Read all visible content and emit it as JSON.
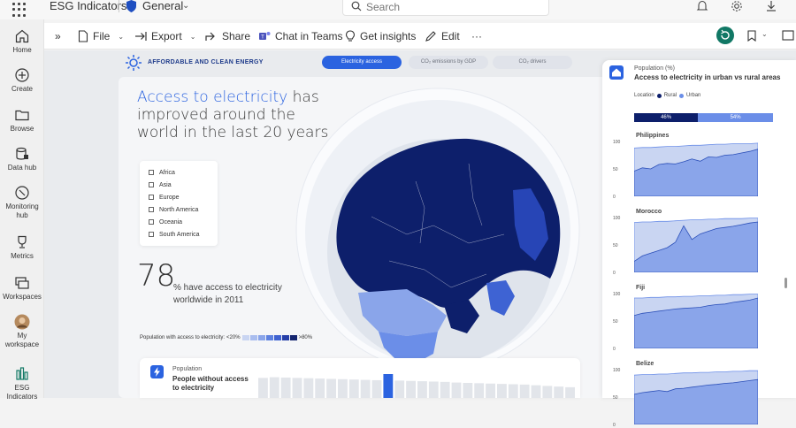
{
  "topbar": {
    "app_title": "ESG Indicators",
    "workspace": "General",
    "search_placeholder": "Search"
  },
  "leftnav": {
    "items": [
      {
        "label": "Home",
        "icon": "home-icon"
      },
      {
        "label": "Create",
        "icon": "plus-circle-icon"
      },
      {
        "label": "Browse",
        "icon": "folder-icon"
      },
      {
        "label": "Data hub",
        "icon": "database-icon"
      },
      {
        "label": "Monitoring hub",
        "icon": "monitor-icon"
      },
      {
        "label": "Metrics",
        "icon": "trophy-icon"
      },
      {
        "label": "Workspaces",
        "icon": "workspaces-icon"
      },
      {
        "label": "My workspace",
        "icon": "avatar-icon"
      },
      {
        "label": "ESG Indicators",
        "icon": "report-icon"
      }
    ]
  },
  "commandbar": {
    "file": "File",
    "export": "Export",
    "share": "Share",
    "chat": "Chat in Teams",
    "insights": "Get insights",
    "edit": "Edit",
    "more": "···"
  },
  "report": {
    "section_label": "AFFORDABLE AND CLEAN ENERGY",
    "tabs": [
      "Electricity access",
      "CO₂ emissions by GDP",
      "CO₂ drivers"
    ],
    "active_tab": 0,
    "headline_highlight": "Access to electricity",
    "headline_rest": " has improved around the world in the last 20 years",
    "regions": [
      "Africa",
      "Asia",
      "Europe",
      "North America",
      "Oceania",
      "South America"
    ],
    "stat_value": "78",
    "stat_text": "% have access to electricity worldwide in 2011",
    "legend_label": "Population with access to electricity:",
    "legend_low": "<20%",
    "legend_high": ">80%",
    "legend_colors": [
      "#c9d5f2",
      "#a9bdef",
      "#8aa5ea",
      "#5d81e0",
      "#3f62d1",
      "#263fa8",
      "#14256f"
    ],
    "bottom_card": {
      "small": "Population",
      "title": "People without access to electricity"
    }
  },
  "right_panel": {
    "small": "Population (%)",
    "title": "Access to electricity in urban vs rural areas",
    "location_label": "Location",
    "legend": [
      {
        "name": "Rural",
        "color": "#0d1f6b"
      },
      {
        "name": "Urban",
        "color": "#6b8ee8"
      }
    ],
    "ratio": [
      {
        "label": "46%",
        "value": 46,
        "color": "#0d1f6b"
      },
      {
        "label": "54%",
        "value": 54,
        "color": "#6b8ee8"
      }
    ],
    "countries": [
      "Philippines",
      "Morocco",
      "Fiji",
      "Belize"
    ],
    "ticks": [
      "100",
      "50",
      "0"
    ]
  },
  "chart_data": [
    {
      "type": "area",
      "title": "Philippines",
      "ylim": [
        0,
        100
      ],
      "series": [
        {
          "name": "Urban",
          "values": [
            88,
            89,
            89,
            90,
            91,
            91,
            92,
            93,
            93,
            94,
            95,
            95,
            96,
            96,
            96,
            97
          ]
        },
        {
          "name": "Rural",
          "values": [
            46,
            52,
            50,
            58,
            60,
            59,
            63,
            68,
            64,
            72,
            71,
            75,
            76,
            79,
            82,
            86
          ]
        }
      ]
    },
    {
      "type": "area",
      "title": "Morocco",
      "ylim": [
        0,
        100
      ],
      "series": [
        {
          "name": "Urban",
          "values": [
            91,
            92,
            92,
            93,
            93,
            94,
            95,
            96,
            96,
            97,
            97,
            98,
            98,
            98,
            99,
            99
          ]
        },
        {
          "name": "Rural",
          "values": [
            20,
            30,
            35,
            40,
            45,
            55,
            85,
            60,
            70,
            75,
            80,
            82,
            84,
            87,
            90,
            92
          ]
        }
      ]
    },
    {
      "type": "area",
      "title": "Fiji",
      "ylim": [
        0,
        100
      ],
      "series": [
        {
          "name": "Urban",
          "values": [
            92,
            92,
            93,
            93,
            94,
            94,
            95,
            95,
            96,
            96,
            97,
            97,
            98,
            98,
            99,
            99
          ]
        },
        {
          "name": "Rural",
          "values": [
            60,
            64,
            66,
            68,
            70,
            72,
            73,
            74,
            75,
            78,
            80,
            81,
            84,
            86,
            88,
            92
          ]
        }
      ]
    },
    {
      "type": "area",
      "title": "Belize",
      "ylim": [
        0,
        100
      ],
      "series": [
        {
          "name": "Urban",
          "values": [
            90,
            91,
            91,
            92,
            92,
            93,
            94,
            94,
            95,
            95,
            96,
            96,
            97,
            97,
            98,
            98
          ]
        },
        {
          "name": "Rural",
          "values": [
            55,
            58,
            60,
            62,
            60,
            65,
            66,
            68,
            70,
            72,
            73,
            75,
            76,
            78,
            80,
            82
          ]
        }
      ]
    },
    {
      "type": "bar",
      "title": "People without access to electricity",
      "values": [
        60,
        62,
        61,
        60,
        59,
        58,
        57,
        56,
        55,
        54,
        53,
        100,
        52,
        51,
        50,
        49,
        48,
        46,
        45,
        44,
        43,
        42,
        41,
        40,
        38,
        36,
        34,
        32
      ],
      "highlight_index": 11
    }
  ]
}
